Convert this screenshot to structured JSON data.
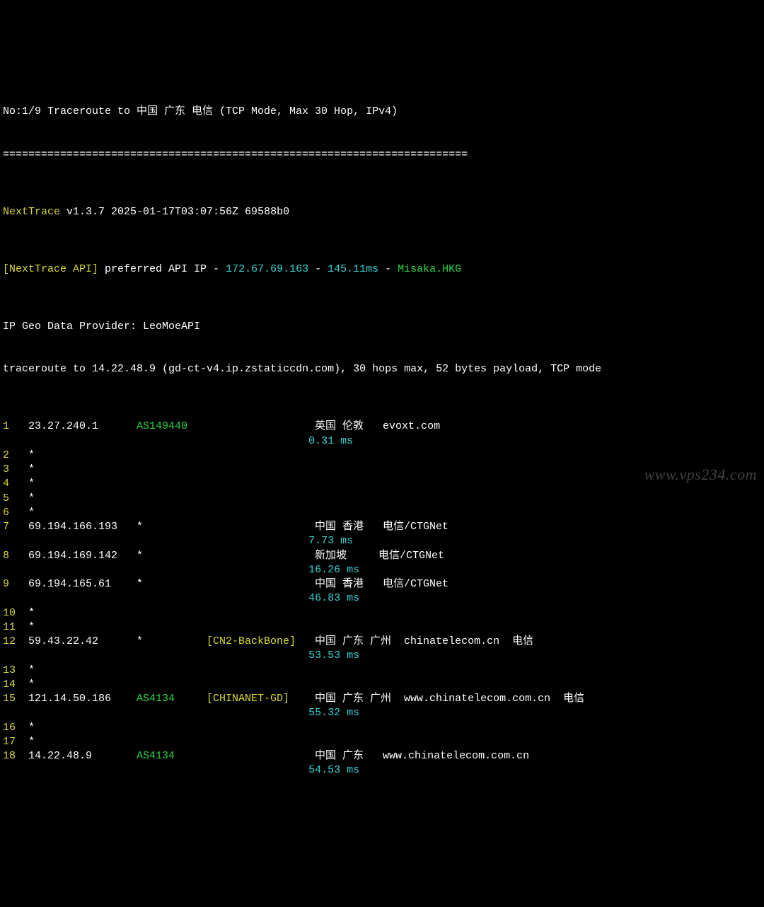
{
  "header": {
    "title": "No:1/9 Traceroute to 中国 广东 电信 (TCP Mode, Max 30 Hop, IPv4)",
    "divider": "=========================================================================",
    "app_name": "NextTrace",
    "version_line": " v1.3.7 2025-01-17T03:07:56Z 69588b0",
    "api_label": "[NextTrace API]",
    "api_text": " preferred API IP - ",
    "api_ip": "172.67.69.163",
    "api_sep": " - ",
    "api_latency": "145.11ms",
    "api_sep2": " - ",
    "api_node": "Misaka.HKG",
    "provider": "IP Geo Data Provider: LeoMoeAPI",
    "traceroute": "traceroute to 14.22.48.9 (gd-ct-v4.ip.zstaticcdn.com), 30 hops max, 52 bytes payload, TCP mode"
  },
  "hops": [
    {
      "n": "1",
      "ip": "23.27.240.1",
      "asn": "AS149440",
      "net": "",
      "geo": "英国 伦敦   evoxt.com",
      "lat": "0.31 ms"
    },
    {
      "n": "2",
      "star": "*"
    },
    {
      "n": "3",
      "star": "*"
    },
    {
      "n": "4",
      "star": "*"
    },
    {
      "n": "5",
      "star": "*"
    },
    {
      "n": "6",
      "star": "*"
    },
    {
      "n": "7",
      "ip": "69.194.166.193",
      "asn": "*",
      "asn_nocolor": true,
      "net": "",
      "geo": "中国 香港   电信/CTGNet",
      "lat": "7.73 ms"
    },
    {
      "n": "8",
      "ip": "69.194.169.142",
      "asn": "*",
      "asn_nocolor": true,
      "net": "",
      "geo": "新加坡     电信/CTGNet",
      "lat": "16.26 ms"
    },
    {
      "n": "9",
      "ip": "69.194.165.61",
      "asn": "*",
      "asn_nocolor": true,
      "net": "",
      "geo": "中国 香港   电信/CTGNet",
      "lat": "46.83 ms"
    },
    {
      "n": "10",
      "star": "*"
    },
    {
      "n": "11",
      "star": "*"
    },
    {
      "n": "12",
      "ip": "59.43.22.42",
      "asn": "*",
      "asn_nocolor": true,
      "net": "[CN2-BackBone]",
      "geo": "中国 广东 广州  chinatelecom.cn  电信",
      "lat": "53.53 ms"
    },
    {
      "n": "13",
      "star": "*"
    },
    {
      "n": "14",
      "star": "*"
    },
    {
      "n": "15",
      "ip": "121.14.50.186",
      "asn": "AS4134",
      "net": "[CHINANET-GD]",
      "geo": "中国 广东 广州  www.chinatelecom.com.cn  电信",
      "lat": "55.32 ms"
    },
    {
      "n": "16",
      "star": "*"
    },
    {
      "n": "17",
      "star": "*"
    },
    {
      "n": "18",
      "ip": "14.22.48.9",
      "asn": "AS4134",
      "net": "",
      "geo": "中国 广东   www.chinatelecom.com.cn",
      "lat": "54.53 ms"
    }
  ],
  "watermark": "www.vps234.com"
}
